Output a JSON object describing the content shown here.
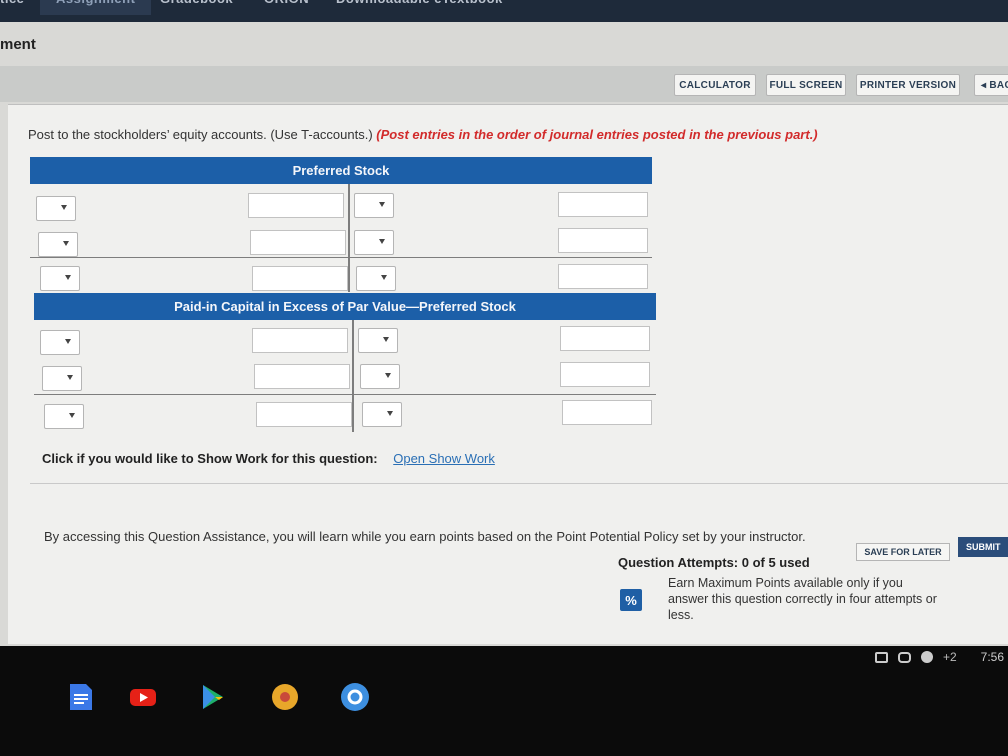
{
  "tabs": [
    "tice",
    "Assignment",
    "Gradebook",
    "ORION",
    "Downloadable eTextbook"
  ],
  "page_heading": "ment",
  "toolbar": {
    "calculator": "CALCULATOR",
    "full_screen": "FULL SCREEN",
    "printer_version": "PRINTER VERSION",
    "back": "◂ BAC"
  },
  "instruction": {
    "text": "Post to the stockholders’ equity accounts. (Use T-accounts.)",
    "note": "(Post entries in the order of journal entries posted in the previous part.)"
  },
  "taccounts": [
    {
      "title": "Preferred Stock"
    },
    {
      "title": "Paid-in Capital in Excess of Par Value—Preferred Stock"
    }
  ],
  "show_work": {
    "prompt": "Click if you would like to Show Work for this question:",
    "link": "Open Show Work"
  },
  "assistance_text": "By accessing this Question Assistance, you will learn while you earn points based on the Point Potential Policy set by your instructor.",
  "attempts": "Question Attempts: 0 of 5 used",
  "save_label": "SAVE FOR LATER",
  "submit_label": "SUBMIT",
  "percent_badge": "%",
  "earn_text": "Earn Maximum Points available only if you answer this question correctly in four attempts or less.",
  "tray": {
    "extra": "+2",
    "time": "7:56"
  },
  "apps": [
    "docs-icon",
    "youtube-icon",
    "play-store-icon",
    "chrome-icon",
    "settings-icon"
  ],
  "colors": {
    "header_blue": "#1c5fa8",
    "note_red": "#d22b2b",
    "link_blue": "#2a6fb5"
  }
}
